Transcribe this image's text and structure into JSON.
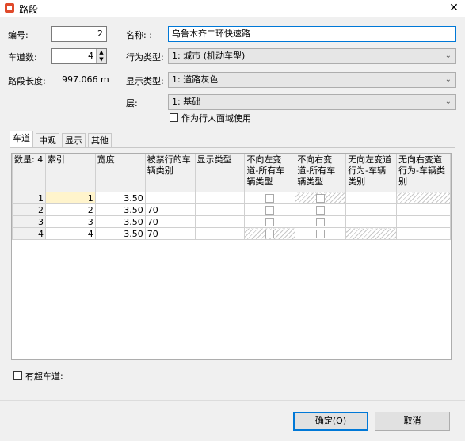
{
  "window": {
    "title": "路段",
    "close_glyph": "✕"
  },
  "form": {
    "id_label": "编号:",
    "id_value": "2",
    "lanes_label": "车道数:",
    "lanes_value": "4",
    "length_label": "路段长度:",
    "length_value": "997.066 m",
    "name_label": "名称: :",
    "name_value": "乌鲁木齐二环快速路",
    "behavior_label": "行为类型:",
    "behavior_value": "1: 城市 (机动车型)",
    "display_label": "显示类型:",
    "display_value": "1: 道路灰色",
    "layer_label": "层:",
    "layer_value": "1: 基础",
    "pedestrian_label": "作为行人面域使用"
  },
  "tabs": [
    {
      "label": "车道"
    },
    {
      "label": "中观"
    },
    {
      "label": "显示"
    },
    {
      "label": "其他"
    }
  ],
  "grid": {
    "headers": [
      "数量: 4",
      "索引",
      "宽度",
      "被禁行的车辆类别",
      "显示类型",
      "不向左变道-所有车辆类型",
      "不向右变道-所有车辆类型",
      "无向左变道行为-车辆类别",
      "无向右变道行为-车辆类别"
    ],
    "rows": [
      {
        "n": "1",
        "index": "1",
        "width": "3.50",
        "blocked": ""
      },
      {
        "n": "2",
        "index": "2",
        "width": "3.50",
        "blocked": "70"
      },
      {
        "n": "3",
        "index": "3",
        "width": "3.50",
        "blocked": "70"
      },
      {
        "n": "4",
        "index": "4",
        "width": "3.50",
        "blocked": "70"
      }
    ]
  },
  "overtake_label": "有超车道:",
  "buttons": {
    "ok": "确定(O)",
    "cancel": "取消"
  }
}
